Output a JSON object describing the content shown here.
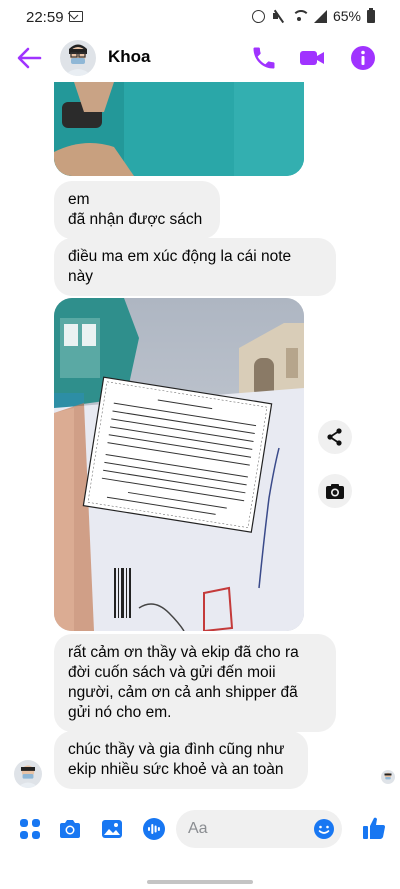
{
  "status_bar": {
    "time": "22:59",
    "battery_percent": "65%",
    "icons": [
      "message-icon",
      "alarm-icon",
      "mute-icon",
      "wifi-icon",
      "signal-icon",
      "battery-icon"
    ]
  },
  "header": {
    "contact_name": "Khoa",
    "icons": [
      "back-arrow-icon",
      "phone-icon",
      "video-camera-icon",
      "info-icon"
    ]
  },
  "messages": [
    {
      "type": "image",
      "description_icon": "photo"
    },
    {
      "type": "text",
      "lines": [
        "em",
        "đã nhận được sách"
      ]
    },
    {
      "type": "text",
      "lines": [
        "điều ma em xúc động la cái note",
        "này"
      ]
    },
    {
      "type": "image",
      "description_icon": "photo"
    },
    {
      "type": "text",
      "lines": [
        "rất cảm ơn thầy và ekip đã cho ra",
        "đời cuốn sách và gửi đến moii",
        "người, cảm ơn cả anh shipper đã",
        "gửi nó cho em."
      ]
    },
    {
      "type": "text",
      "lines": [
        "chúc thầy và gia đình cũng như",
        "ekip nhiều sức khoẻ và an toàn"
      ]
    }
  ],
  "composer": {
    "placeholder": "Aa",
    "icons": [
      "menu-dots-icon",
      "camera-icon",
      "gallery-icon",
      "microphone-icon",
      "emoji-icon",
      "thumbs-up-icon"
    ]
  },
  "colors": {
    "accent": "#a033ff",
    "bubble_bg": "#f0f0f0",
    "like_blue": "#1877f2"
  }
}
